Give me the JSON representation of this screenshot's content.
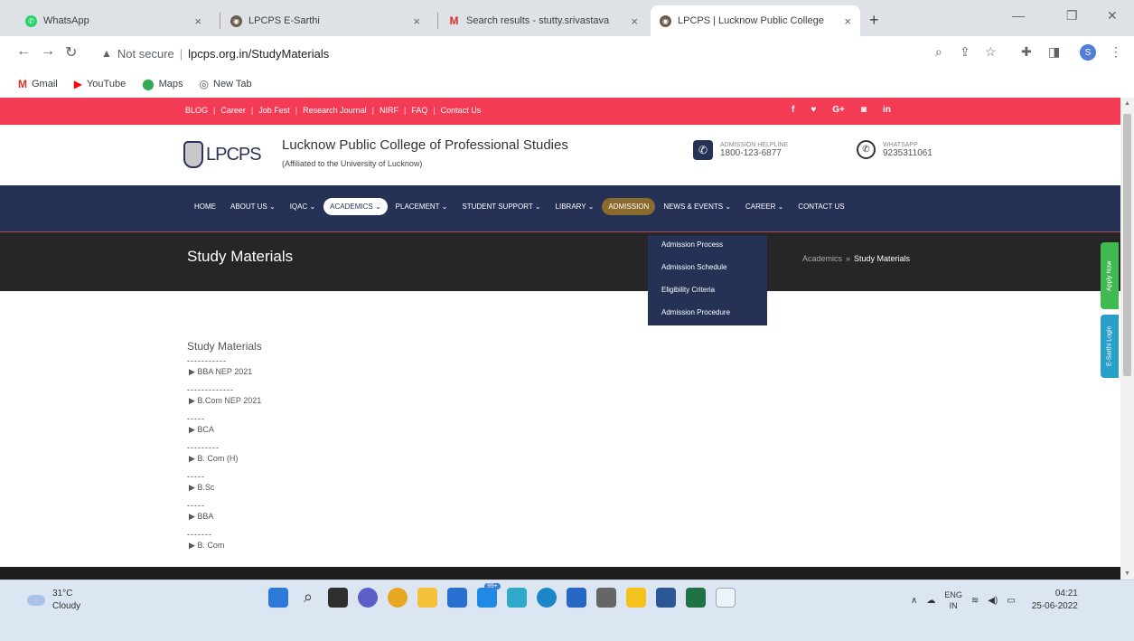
{
  "browser": {
    "tabs": [
      {
        "title": "WhatsApp",
        "icon": "whatsapp-icon",
        "active": false
      },
      {
        "title": "LPCPS E-Sarthi",
        "icon": "lpcps-icon",
        "active": false
      },
      {
        "title": "Search results - stutty.srivastava",
        "icon": "gmail-icon",
        "active": false
      },
      {
        "title": "LPCPS | Lucknow Public College",
        "icon": "lpcps-icon",
        "active": true
      }
    ],
    "address": {
      "warning": "Not secure",
      "url": "lpcps.org.in/StudyMaterials"
    },
    "profile_initial": "S",
    "bookmarks": [
      {
        "label": "Gmail",
        "icon": "gmail-icon"
      },
      {
        "label": "YouTube",
        "icon": "youtube-icon"
      },
      {
        "label": "Maps",
        "icon": "maps-icon"
      },
      {
        "label": "New Tab",
        "icon": "chrome-icon"
      }
    ]
  },
  "site": {
    "toplinks": [
      "BLOG",
      "Career",
      "Job Fest",
      "Research Journal",
      "NIRF",
      "FAQ",
      "Contact Us"
    ],
    "social": [
      "f",
      "t",
      "G+",
      "ig",
      "in"
    ],
    "logo_text": "LPCPS",
    "college_title": "Lucknow Public College of Professional Studies",
    "college_sub": "(Affiliated to the University of Lucknow)",
    "helpline_label": "ADMISSION HELPLINE",
    "helpline_number": "1800-123-6877",
    "whatsapp_label": "WHATSAPP",
    "whatsapp_number": "9235311061",
    "nav": [
      "HOME",
      "ABOUT US ⌄",
      "IQAC ⌄",
      "ACADEMICS ⌄",
      "PLACEMENT ⌄",
      "STUDENT SUPPORT ⌄",
      "LIBRARY ⌄",
      "ADMISSION",
      "NEWS & EVENTS ⌄",
      "CAREER ⌄",
      "CONTACT US"
    ],
    "nav_selected": "ACADEMICS ⌄",
    "nav_hover": "ADMISSION",
    "admission_menu": [
      "Admission Process",
      "Admission Schedule",
      "Eligibility Criteria",
      "Admission Procedure"
    ],
    "page_title": "Study Materials",
    "breadcrumb": {
      "parent": "Academics",
      "sep": "»",
      "current": "Study Materials"
    },
    "materials_heading": "Study Materials",
    "materials": [
      {
        "label": "BBA NEP 2021",
        "dashes": "-----------"
      },
      {
        "label": "B.Com NEP 2021",
        "dashes": "-------------"
      },
      {
        "label": "BCA",
        "dashes": "-----"
      },
      {
        "label": "B. Com (H)",
        "dashes": "---------"
      },
      {
        "label": "B.Sc",
        "dashes": "-----"
      },
      {
        "label": "BBA",
        "dashes": "-----"
      },
      {
        "label": "B. Com",
        "dashes": "-------"
      }
    ],
    "side_apply": "Apply Now",
    "side_esarthi": "E-Sarthi Login"
  },
  "taskbar": {
    "weather_temp": "31°C",
    "weather_desc": "Cloudy",
    "badge": "99+",
    "lang": "ENG",
    "region": "IN",
    "time": "04:21",
    "date": "25-06-2022"
  },
  "colors": {
    "topbar": "#f33b55",
    "nav": "#253256",
    "banner": "#262626",
    "accent_hover": "#8a6a2d"
  }
}
